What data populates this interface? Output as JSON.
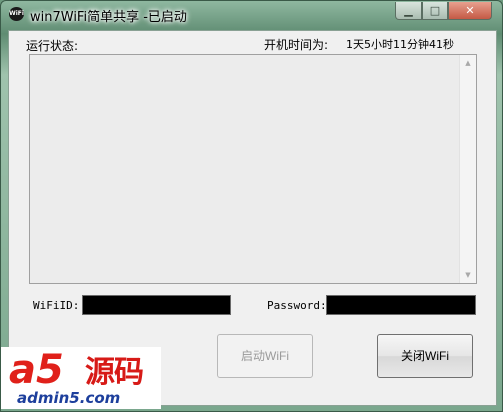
{
  "window": {
    "title": "win7WiFi简单共享 -已启动",
    "icon_text": "WiFi",
    "icons": {
      "app": "wifi-app-icon",
      "minimize": "minimize-icon",
      "maximize": "maximize-icon",
      "close": "close-icon"
    },
    "caption_glyphs": {
      "minimize": "▁",
      "maximize": "□",
      "close": "✕"
    }
  },
  "status": {
    "label": "运行状态:",
    "log_text": ""
  },
  "uptime": {
    "label": "开机时间为:",
    "value": "1天5小时11分钟41秒"
  },
  "scrollbar": {
    "up_glyph": "▲",
    "down_glyph": "▼"
  },
  "wifi": {
    "id_label": "WiFiID:",
    "id_value": "",
    "password_label": "Password:",
    "password_value": ""
  },
  "buttons": {
    "start_label": "启动WiFi",
    "start_enabled": false,
    "stop_label": "关闭WiFi"
  },
  "watermark": {
    "logo_a5": "a5",
    "logo_cn": "源码",
    "logo_url": "admin5.com"
  },
  "colors": {
    "title_background": "#6d9a7f",
    "close_button": "#c45a45",
    "input_background": "#000000",
    "logo_red": "#e0201a",
    "logo_blue": "#1d3f9c"
  }
}
